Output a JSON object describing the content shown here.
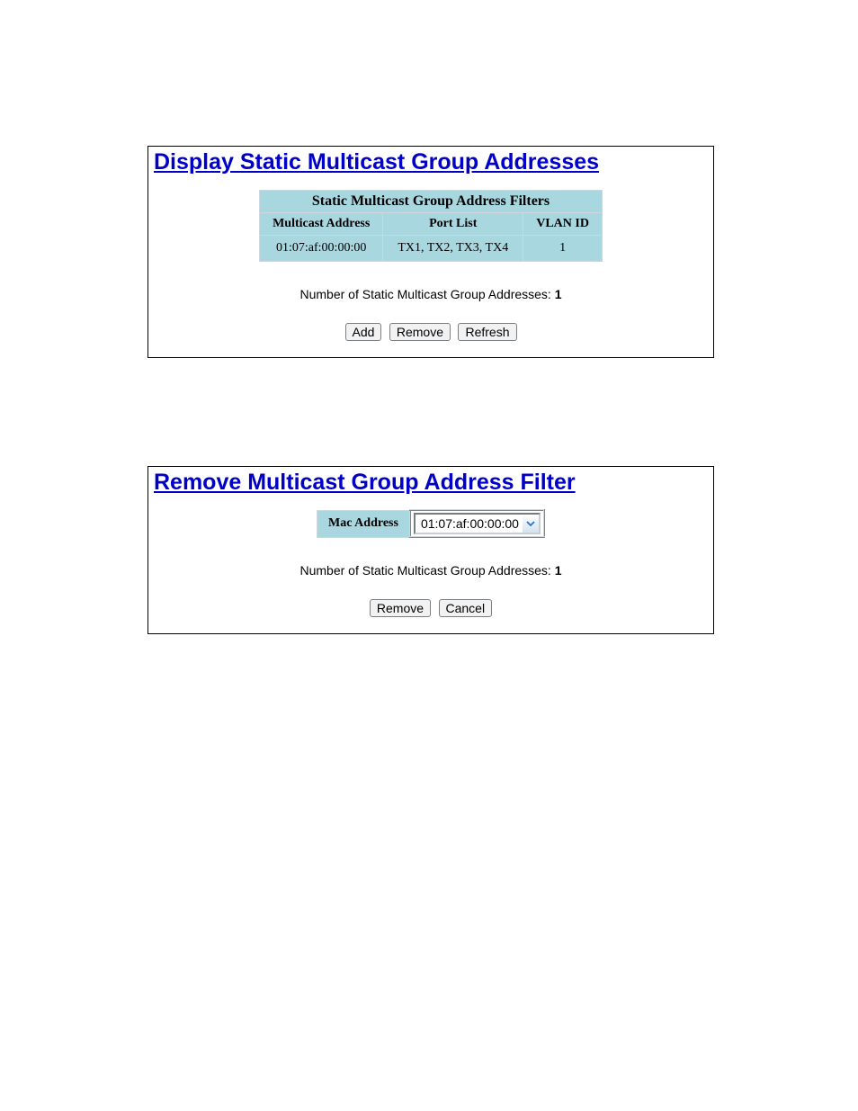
{
  "panel1": {
    "title": "Display Static Multicast Group Addresses",
    "caption": "Static Multicast Group Address Filters",
    "headers": [
      "Multicast Address",
      "Port List",
      "VLAN ID"
    ],
    "rows": [
      {
        "address": "01:07:af:00:00:00",
        "ports": "TX1, TX2, TX3, TX4",
        "vlan": "1"
      }
    ],
    "count_label": "Number of Static Multicast Group Addresses: ",
    "count": "1",
    "buttons": {
      "add": "Add",
      "remove": "Remove",
      "refresh": "Refresh"
    }
  },
  "panel2": {
    "title": "Remove Multicast Group Address Filter",
    "mac_label": "Mac Address",
    "selected_mac": "01:07:af:00:00:00",
    "count_label": "Number of Static Multicast Group Addresses: ",
    "count": "1",
    "buttons": {
      "remove": "Remove",
      "cancel": "Cancel"
    }
  }
}
